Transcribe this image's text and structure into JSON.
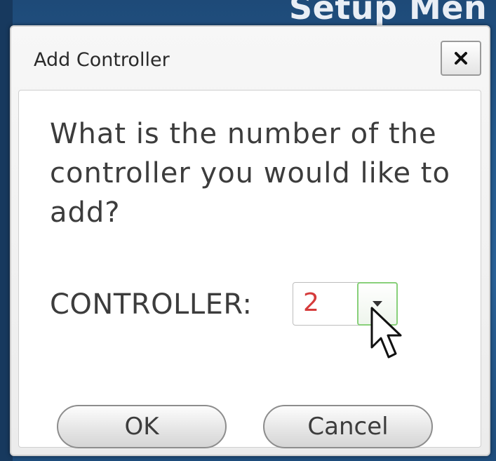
{
  "background": {
    "title_fragment": "Setup Men"
  },
  "dialog": {
    "title": "Add Controller",
    "close_icon": "close-icon",
    "question": "What is the number of the controller you would like to add?",
    "controller_label": "CONTROLLER:",
    "controller_value": "2",
    "dropdown_icon": "chevron-down-icon",
    "ok_label": "OK",
    "cancel_label": "Cancel"
  },
  "colors": {
    "value_text": "#d53b3b",
    "dropdown_accent": "#88d07a",
    "background": "#245a8e"
  }
}
